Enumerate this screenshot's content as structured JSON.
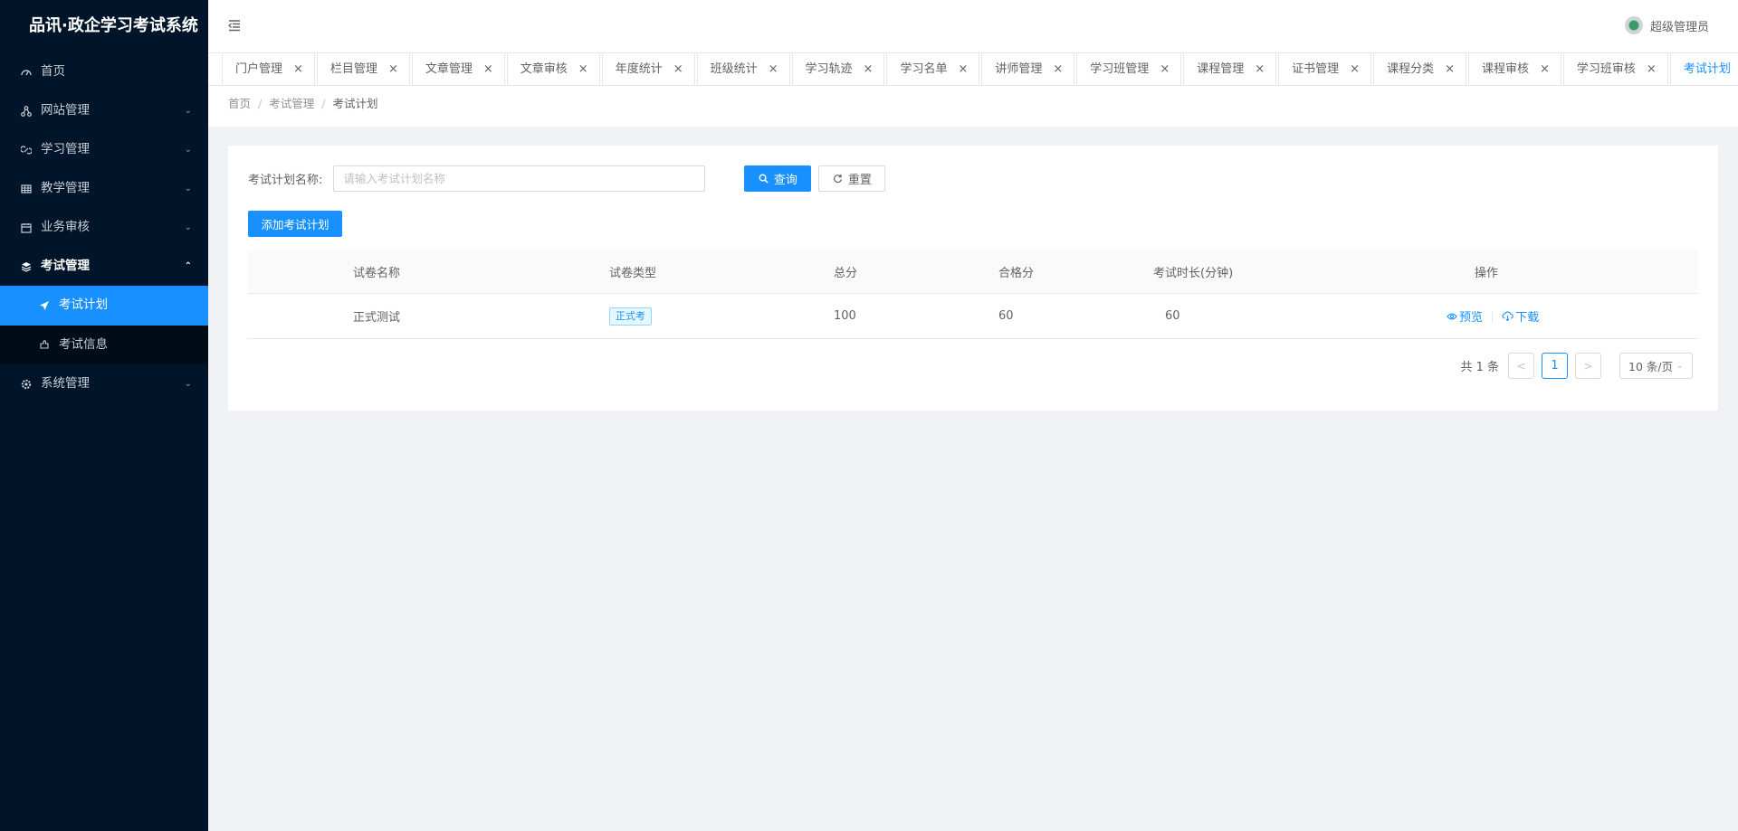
{
  "app": {
    "title": "品讯·政企学习考试系统"
  },
  "sidebar": {
    "items": [
      {
        "label": "首页",
        "icon": "dashboard-icon"
      },
      {
        "label": "网站管理",
        "icon": "sitemap-icon"
      },
      {
        "label": "学习管理",
        "icon": "link-icon"
      },
      {
        "label": "教学管理",
        "icon": "table-icon"
      },
      {
        "label": "业务审核",
        "icon": "calendar-icon"
      },
      {
        "label": "考试管理",
        "icon": "layers-icon"
      },
      {
        "label": "系统管理",
        "icon": "settings-icon"
      }
    ],
    "sub_items": [
      {
        "label": "考试计划",
        "icon": "send-icon"
      },
      {
        "label": "考试信息",
        "icon": "puzzle-icon"
      }
    ]
  },
  "header": {
    "user_name": "超级管理员"
  },
  "tabs": [
    {
      "label": "门户管理"
    },
    {
      "label": "栏目管理"
    },
    {
      "label": "文章管理"
    },
    {
      "label": "文章审核"
    },
    {
      "label": "年度统计"
    },
    {
      "label": "班级统计"
    },
    {
      "label": "学习轨迹"
    },
    {
      "label": "学习名单"
    },
    {
      "label": "讲师管理"
    },
    {
      "label": "学习班管理"
    },
    {
      "label": "课程管理"
    },
    {
      "label": "证书管理"
    },
    {
      "label": "课程分类"
    },
    {
      "label": "课程审核"
    },
    {
      "label": "学习班审核"
    },
    {
      "label": "考试计划"
    }
  ],
  "breadcrumb": {
    "home": "首页",
    "parent": "考试管理",
    "current": "考试计划"
  },
  "search": {
    "label": "考试计划名称:",
    "placeholder": "请输入考试计划名称",
    "value": "",
    "search_label": "查询",
    "reset_label": "重置",
    "add_label": "添加考试计划"
  },
  "table": {
    "headers": [
      "试卷名称",
      "试卷类型",
      "总分",
      "合格分",
      "考试时长(分钟)",
      "操作"
    ],
    "rows": [
      {
        "name": "正式测试",
        "type": "正式考",
        "total": "100",
        "pass": "60",
        "duration": "60",
        "preview": "预览",
        "download": "下载"
      }
    ]
  },
  "pagination": {
    "total": "共 1 条",
    "current_page": "1",
    "page_size": "10 条/页"
  },
  "colors": {
    "primary": "#1890ff",
    "sidebar_bg": "#001529",
    "submenu_bg": "#000c17"
  }
}
